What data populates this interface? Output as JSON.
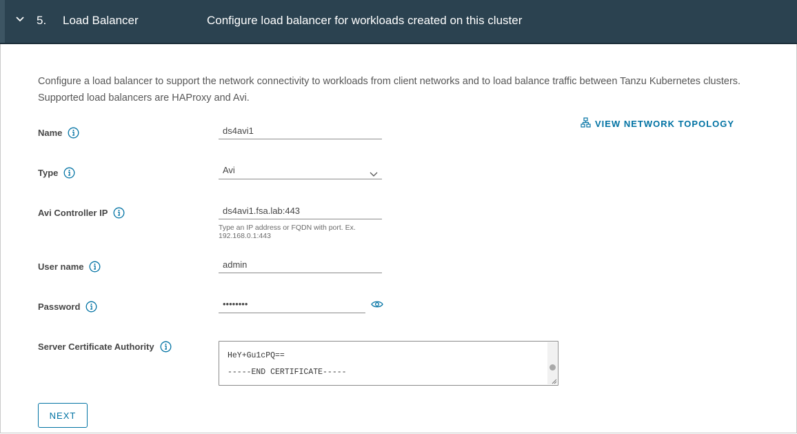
{
  "header": {
    "step_number": "5.",
    "step_title": "Load Balancer",
    "step_description": "Configure load balancer for workloads created on this cluster"
  },
  "intro_text": "Configure a load balancer to support the network connectivity to workloads from client networks and to load balance traffic between Tanzu Kubernetes clusters. Supported load balancers are HAProxy and Avi.",
  "topology_link": {
    "label": "VIEW NETWORK TOPOLOGY",
    "icon": "network-topology-icon"
  },
  "form": {
    "name": {
      "label": "Name",
      "value": "ds4avi1"
    },
    "type": {
      "label": "Type",
      "value": "Avi"
    },
    "controller_ip": {
      "label": "Avi Controller IP",
      "value": "ds4avi1.fsa.lab:443",
      "help_line1": "Type an IP address or FQDN with port. Ex.",
      "help_line2": "192.168.0.1:443"
    },
    "username": {
      "label": "User name",
      "value": "admin"
    },
    "password": {
      "label": "Password",
      "value": "••••••••"
    },
    "certificate": {
      "label": "Server Certificate Authority",
      "line1": "HeY+Gu1cPQ==",
      "line2": "-----END CERTIFICATE-----"
    }
  },
  "next_button": {
    "label": "NEXT"
  },
  "colors": {
    "header_bg": "#2b4250",
    "link_blue": "#0072a3",
    "text_dark": "#454545"
  }
}
